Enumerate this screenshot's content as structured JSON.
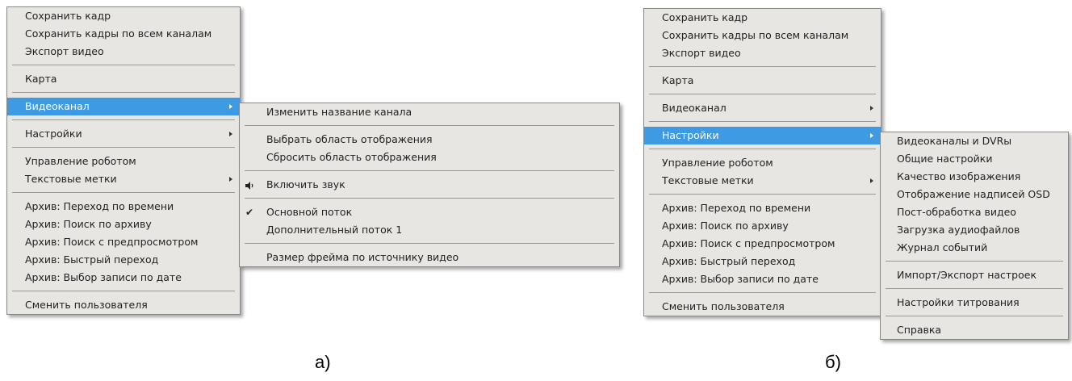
{
  "main_menu_a": {
    "group1": [
      "Сохранить кадр",
      "Сохранить кадры по всем каналам",
      "Экспорт видео"
    ],
    "group2": [
      "Карта"
    ],
    "group3": [
      "Видеоканал"
    ],
    "group4": [
      "Настройки"
    ],
    "group5": [
      "Управление роботом",
      "Текстовые метки"
    ],
    "group6": [
      "Архив: Переход по времени",
      "Архив: Поиск по архиву",
      "Архив: Поиск с предпросмотром",
      "Архив: Быстрый переход",
      "Архив: Выбор записи по дате"
    ],
    "group7": [
      "Сменить пользователя"
    ],
    "active_item": "Видеоканал"
  },
  "submenu_videochannel": {
    "items": [
      "Изменить название канала",
      "Выбрать область отображения",
      "Сбросить область отображения",
      "Включить звук",
      "Основной поток",
      "Дополнительный поток 1",
      "Размер фрейма по источнику видео"
    ],
    "sound_icon": "speaker-icon",
    "checked_item": "Основной поток",
    "check_icon": "checkmark-icon"
  },
  "main_menu_b": {
    "group1": [
      "Сохранить кадр",
      "Сохранить кадры по всем каналам",
      "Экспорт видео"
    ],
    "group2": [
      "Карта"
    ],
    "group3": [
      "Видеоканал"
    ],
    "group4": [
      "Настройки"
    ],
    "group5": [
      "Управление роботом",
      "Текстовые метки"
    ],
    "group6": [
      "Архив: Переход по времени",
      "Архив: Поиск по архиву",
      "Архив: Поиск с предпросмотром",
      "Архив: Быстрый переход",
      "Архив: Выбор записи по дате"
    ],
    "group7": [
      "Сменить пользователя"
    ],
    "active_item": "Настройки"
  },
  "submenu_settings": {
    "items": [
      "Видеоканалы и DVRы",
      "Общие настройки",
      "Качество изображения",
      "Отображение надписей OSD",
      "Пост-обработка видео",
      "Загрузка аудиофайлов",
      "Журнал событий",
      "Импорт/Экспорт настроек",
      "Настройки титрования",
      "Справка"
    ]
  },
  "captions": {
    "a": "а)",
    "b": "б)"
  },
  "colors": {
    "highlight": "#3d9ae3",
    "menu_bg": "#e8e6e3"
  }
}
